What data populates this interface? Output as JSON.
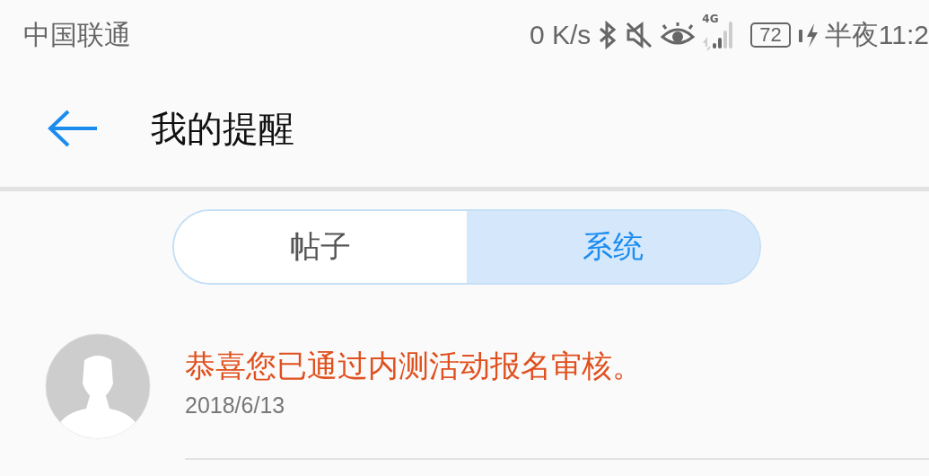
{
  "status_bar": {
    "carrier": "中国联通",
    "net_speed": "0 K/s",
    "network": "4G",
    "battery": "72",
    "time": "半夜11:2"
  },
  "header": {
    "title": "我的提醒"
  },
  "tabs": [
    {
      "label": "帖子",
      "selected": false
    },
    {
      "label": "系统",
      "selected": true
    }
  ],
  "messages": [
    {
      "text": "恭喜您已通过内测活动报名审核。",
      "date": "2018/6/13"
    }
  ]
}
